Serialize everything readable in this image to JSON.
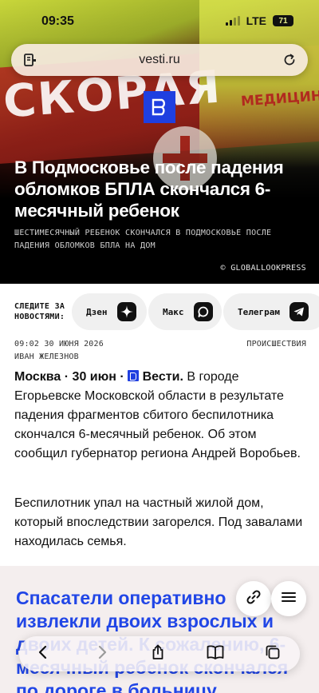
{
  "status_bar": {
    "time": "09:35",
    "network": "LTE",
    "battery": "71"
  },
  "browser": {
    "url": "vesti.ru"
  },
  "hero": {
    "photo_text": "СКОРАЯ",
    "photo_text_2": "МЕДИЦИНСКАЯ",
    "title": "В Подмосковье после падения обломков БПЛА скончался 6-месячный ребенок",
    "subtitle": "Шестимесячный ребенок скончался в Подмосковье после падения обломков БПЛА на дом",
    "credit": "© GLOBALLOOKPRESS"
  },
  "follow": {
    "label_line1": "СЛЕДИТЕ ЗА",
    "label_line2": "НОВОСТЯМИ:",
    "channels": [
      {
        "label": "Дзен"
      },
      {
        "label": "Макс"
      },
      {
        "label": "Телеграм"
      }
    ]
  },
  "meta": {
    "datetime": "09:02 30 ИЮНЯ 2026",
    "author": "ИВАН ЖЕЛЕЗНОВ",
    "category": "ПРОИСШЕСТВИЯ"
  },
  "article": {
    "dateline": "Москва · 30 июн ·",
    "source": "Вести.",
    "p1_text": "В городе Егорьевске Московской области в результате падения фрагментов сбитого беспилотника скончался 6-месячный ребенок. Об этом сообщил губернатор региона Андрей Воробьев.",
    "p2_text": "Беспилотник упал на частный жилой дом, который впоследствии загорелся. Под завалами находилась семья."
  },
  "promo": {
    "title": "Спасатели оперативно извлекли двоих взрослых и двоих детей. К сожалению, 6-месячный ребенок скончался по дороге в больницу"
  },
  "colors": {
    "brand_blue": "#1f3fe0",
    "promo_text": "#2146e6",
    "promo_bg": "#f4eeee"
  },
  "icons": {
    "url_left": "reader-icon",
    "url_right": "reload-icon",
    "dzen": "dzen-star-icon",
    "max": "max-chat-icon",
    "telegram": "telegram-plane-icon",
    "fab_share": "link-icon",
    "fab_menu": "hamburger-menu-icon",
    "toolbar": [
      "back-icon",
      "forward-icon",
      "share-icon",
      "bookmarks-icon",
      "tabs-icon"
    ]
  }
}
